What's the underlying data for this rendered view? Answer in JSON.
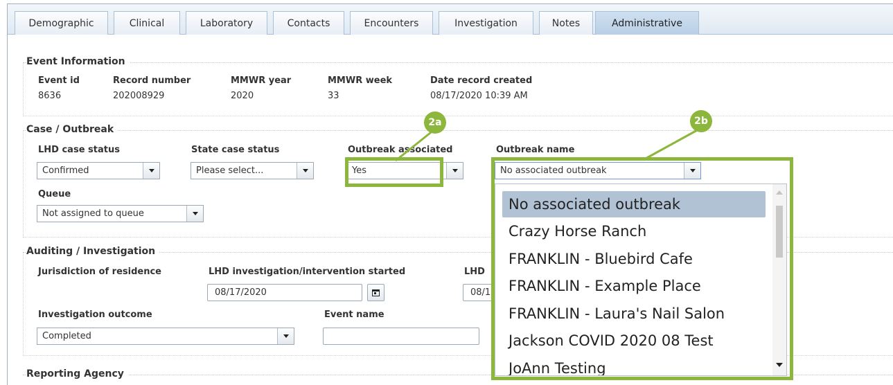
{
  "tabs": [
    "Demographic",
    "Clinical",
    "Laboratory",
    "Contacts",
    "Encounters",
    "Investigation",
    "Notes",
    "Administrative"
  ],
  "event_info": {
    "title": "Event Information",
    "fields": [
      {
        "label": "Event id",
        "value": "8636"
      },
      {
        "label": "Record number",
        "value": "202008929"
      },
      {
        "label": "MMWR year",
        "value": "2020"
      },
      {
        "label": "MMWR week",
        "value": "33"
      },
      {
        "label": "Date record created",
        "value": "08/17/2020 10:39 AM"
      }
    ]
  },
  "case_outbreak": {
    "title": "Case / Outbreak",
    "lhd_case_status": {
      "label": "LHD case status",
      "value": "Confirmed"
    },
    "state_case_status": {
      "label": "State case status",
      "value": "Please select..."
    },
    "outbreak_associated": {
      "label": "Outbreak associated",
      "value": "Yes"
    },
    "outbreak_name": {
      "label": "Outbreak name",
      "value": "No associated outbreak"
    },
    "queue": {
      "label": "Queue",
      "value": "Not assigned to queue"
    }
  },
  "auditing": {
    "title": "Auditing / Investigation",
    "jurisdiction": {
      "label": "Jurisdiction of residence"
    },
    "lhd_started": {
      "label": "LHD investigation/intervention started",
      "value": "08/17/2020"
    },
    "lhd_partial": {
      "label": "LHD",
      "value": "08/1"
    },
    "investigation_outcome": {
      "label": "Investigation outcome",
      "value": "Completed"
    },
    "event_name": {
      "label": "Event name",
      "value": ""
    }
  },
  "reporting_agency": {
    "title": "Reporting Agency"
  },
  "outbreak_dropdown": {
    "items": [
      "No associated outbreak",
      "Crazy Horse Ranch",
      "FRANKLIN - Bluebird Cafe",
      "FRANKLIN - Example Place",
      "FRANKLIN - Laura's Nail Salon",
      "Jackson COVID 2020 08 Test",
      "JoAnn Testing"
    ],
    "selected": "No associated outbreak"
  },
  "callouts": {
    "a": "2a",
    "b": "2b"
  },
  "colors": {
    "highlight": "#8db63c",
    "selected_item": "#b1c2d4",
    "active_tab": "#c3d6ea"
  }
}
